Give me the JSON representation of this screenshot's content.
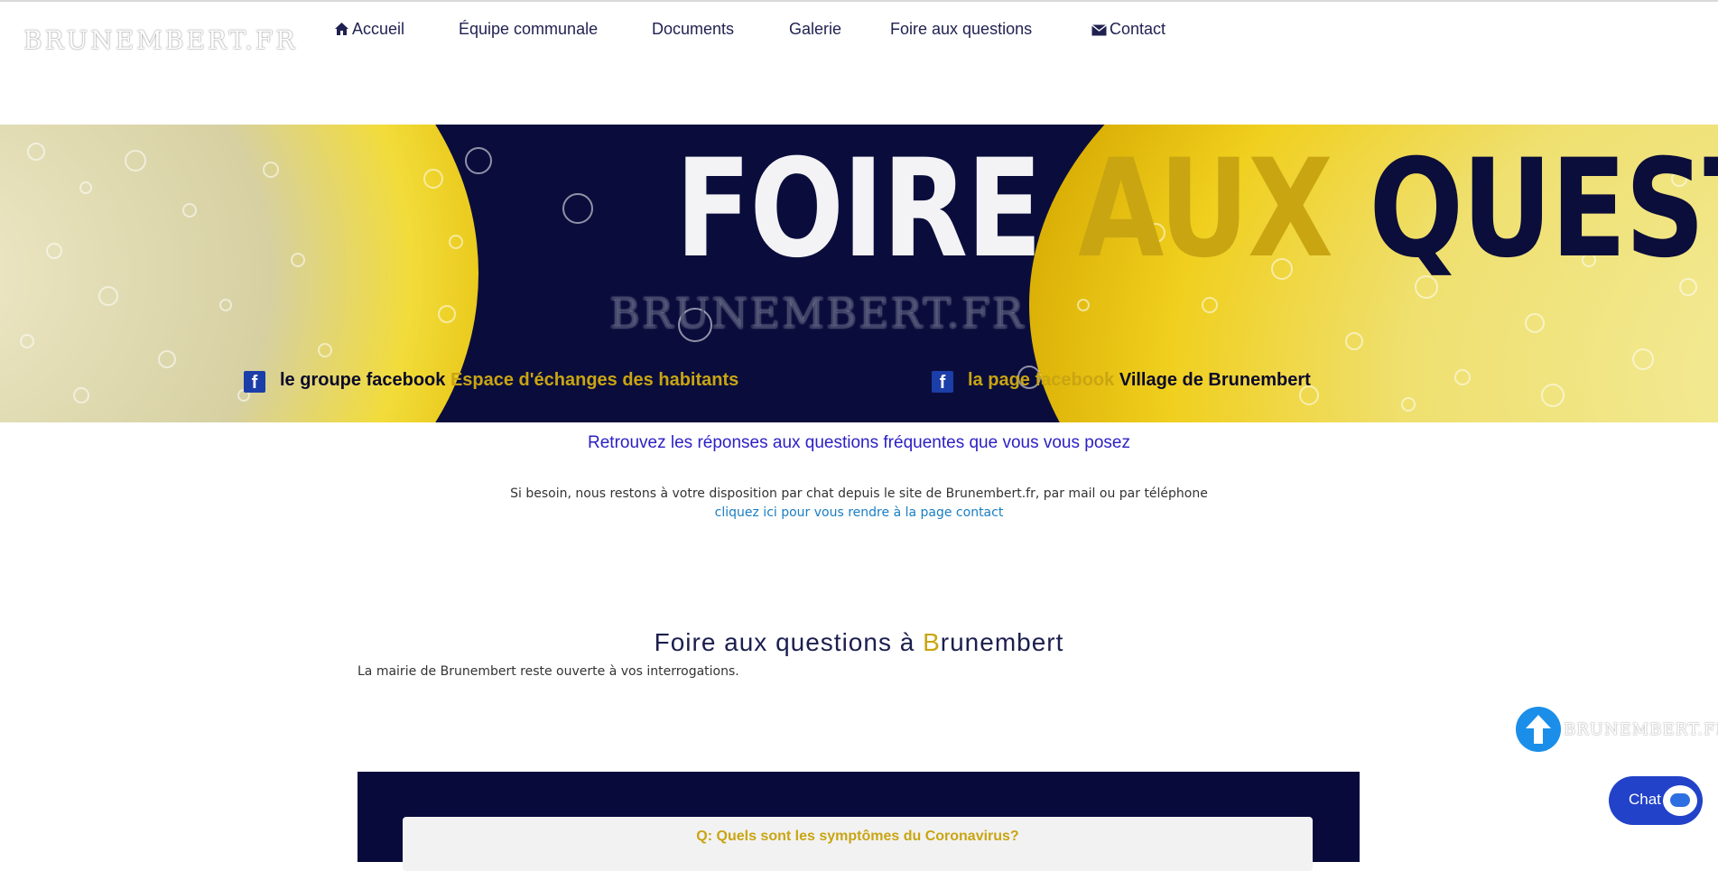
{
  "site": {
    "logo_text": "BRUNEMBERT.FR"
  },
  "nav": {
    "items": [
      {
        "label": "Accueil",
        "icon": "home-icon"
      },
      {
        "label": "Équipe communale"
      },
      {
        "label": "Documents"
      },
      {
        "label": "Galerie"
      },
      {
        "label": "Foire aux questions"
      },
      {
        "label": "Contact",
        "icon": "envelope-icon"
      }
    ]
  },
  "hero": {
    "title_part1": "FOIRE",
    "title_part2": "AUX",
    "title_part3": "QUESTIONS",
    "logo_text": "BRUNEMBERT.FR",
    "facebook_group": {
      "prefix": "le groupe facebook",
      "name": "Espace d'échanges des habitants"
    },
    "facebook_page": {
      "prefix": "la page facebook",
      "name": "Village de Brunembert"
    }
  },
  "intro": {
    "headline": "Retrouvez les réponses aux questions fréquentes que vous vous posez",
    "text": "Si besoin, nous restons à votre disposition par chat depuis le site de Brunembert.fr, par mail ou par téléphone",
    "contact_link": "cliquez ici pour vous rendre à la page contact"
  },
  "faq": {
    "title_before": "Foire aux questions à ",
    "title_initial": "B",
    "title_after": "runembert",
    "intro": "La mairie de Brunembert reste ouverte à vos interrogations.",
    "questions": [
      {
        "question": "Q: Quels sont les symptômes du Coronavirus?"
      }
    ]
  },
  "widgets": {
    "scroll_top_logo": "BRUNEMBERT.FR",
    "chat_label": "Chat"
  },
  "colors": {
    "nav_text": "#1f2150",
    "gold": "#c9a512",
    "navy": "#080a3c",
    "headline_blue": "#2b1fc5",
    "link_blue": "#1a7ec2",
    "chat_blue": "#2242c9",
    "scroll_blue": "#1a8ee8"
  }
}
